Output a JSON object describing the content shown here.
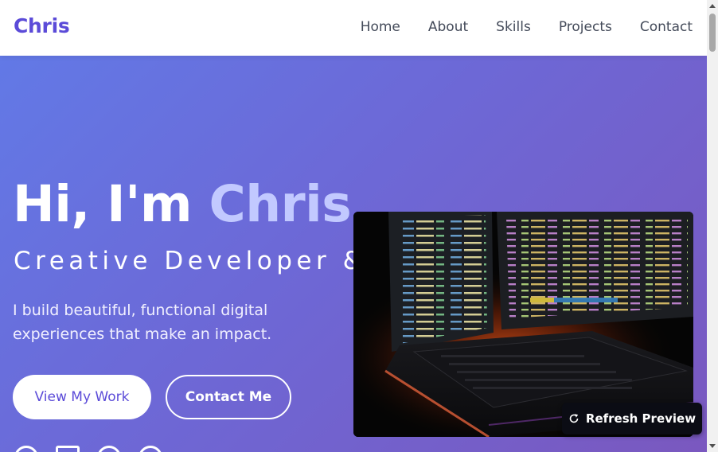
{
  "nav": {
    "logo": "Chris",
    "links": [
      "Home",
      "About",
      "Skills",
      "Projects",
      "Contact"
    ]
  },
  "hero": {
    "greeting": "Hi, I'm ",
    "name": "Chris",
    "subtitle": "Creative Developer &",
    "description": "I build beautiful, functional digital experiences that make an impact.",
    "primary_button": "View My Work",
    "secondary_button": "Contact Me",
    "image_icon": "code-monitors-keyboard-photo",
    "social_icons": [
      "github-icon",
      "mail-icon",
      "twitter-icon",
      "pinterest-icon"
    ]
  },
  "refresh": {
    "label": "Refresh Preview",
    "icon": "refresh-icon"
  },
  "colors": {
    "brand": "#5b4bd8",
    "name_highlight": "#c2c9ff",
    "gradient_start": "#6279e6",
    "gradient_end": "#7a58bf",
    "refresh_bg": "#0b0c14"
  }
}
